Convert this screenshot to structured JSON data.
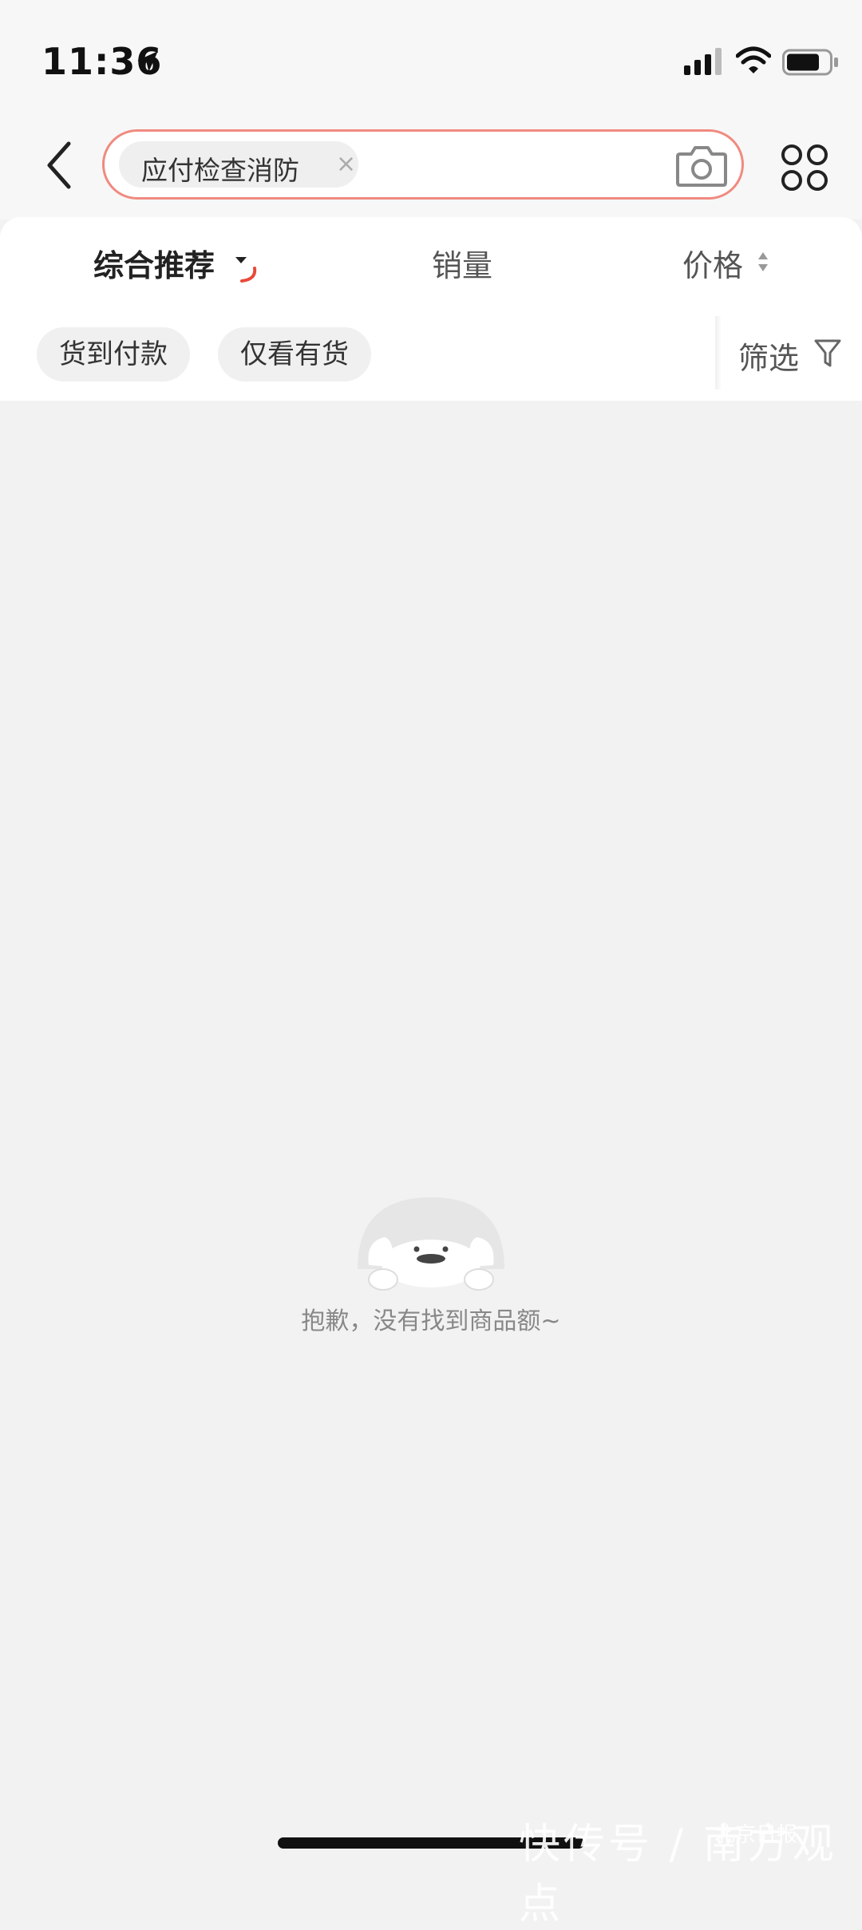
{
  "status_bar": {
    "time": "11:36"
  },
  "search": {
    "tag": "应付检查消防",
    "tag_close": "×"
  },
  "sort_tabs": [
    {
      "label": "综合推荐",
      "active": true
    },
    {
      "label": "销量",
      "active": false
    },
    {
      "label": "价格",
      "active": false
    }
  ],
  "filter_chips": [
    {
      "label": "货到付款"
    },
    {
      "label": "仅看有货"
    }
  ],
  "filter": {
    "label": "筛选"
  },
  "empty_state": {
    "message": "抱歉，没有找到商品额~"
  },
  "watermark": {
    "text": "快传号 / 南方观点",
    "sub": "北京日报"
  },
  "colors": {
    "accent": "#e84a3a",
    "search_border": "#f08a80",
    "background": "#f2f2f2"
  },
  "icons": [
    "location-arrow-icon",
    "cellular-signal-icon",
    "wifi-icon",
    "battery-icon",
    "back-chevron-icon",
    "camera-icon",
    "grid-menu-icon",
    "dropdown-arrow-icon",
    "sort-arrows-icon",
    "funnel-icon"
  ]
}
